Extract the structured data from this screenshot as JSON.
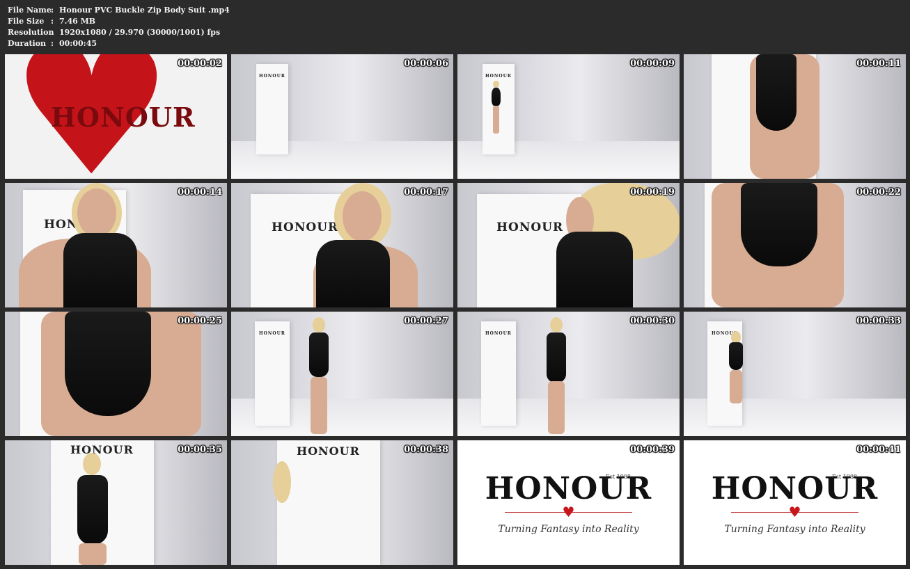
{
  "info": {
    "file_name_label": "File Name",
    "file_name": "Honour PVC Buckle Zip Body Suit .mp4",
    "file_size_label": "File Size",
    "file_size": "7.46 MB",
    "resolution_label": "Resolution",
    "resolution": "1920x1080 / 29.970 (30000/1001) fps",
    "duration_label": "Duration",
    "duration": "00:00:45",
    "separator": ":"
  },
  "brand": {
    "name": "HONOUR",
    "est": "Est 1988",
    "tagline": "Turning Fantasy into Reality",
    "heart_color": "#c8161d"
  },
  "thumbnails": [
    {
      "timestamp": "00:00:02"
    },
    {
      "timestamp": "00:00:06"
    },
    {
      "timestamp": "00:00:09"
    },
    {
      "timestamp": "00:00:11"
    },
    {
      "timestamp": "00:00:14"
    },
    {
      "timestamp": "00:00:17"
    },
    {
      "timestamp": "00:00:19"
    },
    {
      "timestamp": "00:00:22"
    },
    {
      "timestamp": "00:00:25"
    },
    {
      "timestamp": "00:00:27"
    },
    {
      "timestamp": "00:00:30"
    },
    {
      "timestamp": "00:00:33"
    },
    {
      "timestamp": "00:00:35"
    },
    {
      "timestamp": "00:00:38"
    },
    {
      "timestamp": "00:00:39"
    },
    {
      "timestamp": "00:00:41"
    }
  ]
}
